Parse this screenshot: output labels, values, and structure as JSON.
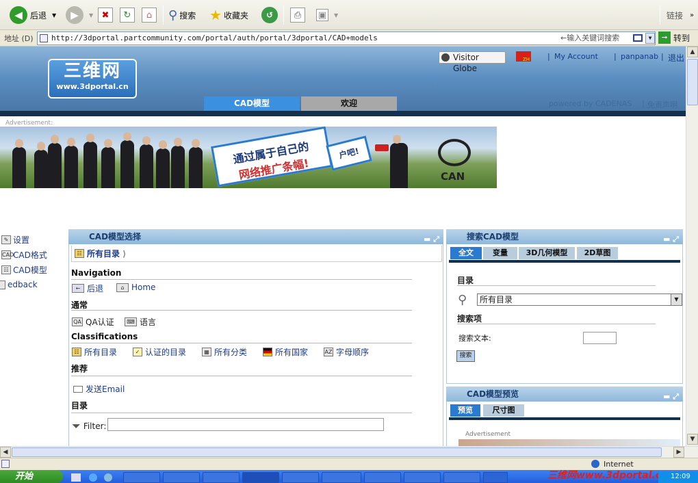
{
  "toolbar": {
    "back_label": "后退",
    "search_label": "搜索",
    "favorites_label": "收藏夹",
    "links_label": "链接"
  },
  "addressbar": {
    "label": "地址 (D)",
    "url": "http://3dportal.partcommunity.com/portal/auth/portal/3dportal/CAD+models",
    "search_placeholder": "←输入关键词搜索",
    "go_label": "转到"
  },
  "header": {
    "logo_title": "三维网",
    "logo_sub": "www.3dportal.cn",
    "visitor_globe": "Visitor Globe",
    "flag_label": "ZH",
    "my_account": "My Account",
    "username": "panpanab",
    "logout": "退出",
    "powered": "powered by CADENAS",
    "disclaimer": "免责声明",
    "nav": [
      "CAD模型",
      "欢迎"
    ]
  },
  "ad": {
    "label": "Advertisement:",
    "bubble_line1": "通过属于自己的",
    "bubble_line2": "网络推广条幅!",
    "bubble_tail": "户吧!",
    "brand": "CAN"
  },
  "left_menu": [
    "设置",
    "CAD格式",
    "CAD模型",
    "edback"
  ],
  "model_select": {
    "title": "CAD模型选择",
    "breadcrumb": "所有目录",
    "sections": {
      "navigation": "Navigation",
      "general": "通常",
      "classifications": "Classifications",
      "recommend": "推荐",
      "catalog": "目录"
    },
    "nav_links": [
      "后退",
      "Home"
    ],
    "general_links": [
      "QA认证",
      "语言"
    ],
    "class_links": [
      "所有目录",
      "认证的目录",
      "所有分类",
      "所有国家",
      "字母顺序"
    ],
    "send_email": "发送Email",
    "filter_label": "Filter:"
  },
  "search": {
    "title": "搜索CAD模型",
    "tabs": [
      "全文",
      "变量",
      "3D几何模型",
      "2D草图"
    ],
    "catalog_label": "目录",
    "catalog_value": "所有目录",
    "search_items_label": "搜索项",
    "search_text_label": "搜索文本:",
    "search_button": "搜索"
  },
  "preview": {
    "title": "CAD模型预览",
    "tabs": [
      "预览",
      "尺寸图"
    ],
    "ad_label": "Advertisement"
  },
  "status": {
    "zone": "Internet"
  },
  "taskbar": {
    "start": "开始",
    "watermark": "三维网www.3dportal.cn",
    "clock": "12:09"
  },
  "colors": {
    "accent": "#3b90e0",
    "header_dark": "#14304f",
    "panel_head": "#8fb7db"
  }
}
